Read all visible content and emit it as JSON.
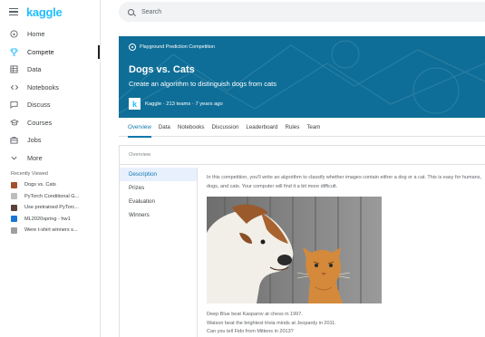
{
  "sidebar": {
    "logo": "kaggle",
    "items": [
      {
        "label": "Home",
        "icon": "home-icon"
      },
      {
        "label": "Compete",
        "icon": "trophy-icon",
        "active": true
      },
      {
        "label": "Data",
        "icon": "table-icon"
      },
      {
        "label": "Notebooks",
        "icon": "code-icon"
      },
      {
        "label": "Discuss",
        "icon": "discuss-icon"
      },
      {
        "label": "Courses",
        "icon": "courses-icon"
      },
      {
        "label": "Jobs",
        "icon": "jobs-icon"
      },
      {
        "label": "More",
        "icon": "chevron-down-icon"
      }
    ],
    "recent_title": "Recently Viewed",
    "recent": [
      {
        "label": "Dogs vs. Cats",
        "color": "#a0522d"
      },
      {
        "label": "PyTorch Conditional G...",
        "color": "#9e9e9e"
      },
      {
        "label": "Use pretrained PyTorc...",
        "color": "#5d4037"
      },
      {
        "label": "ML2020spring - hw1",
        "color": "#1976d2"
      },
      {
        "label": "Were t-shirt winners s...",
        "color": "#9e9e9e"
      }
    ]
  },
  "search": {
    "placeholder": "Search"
  },
  "hero": {
    "badge": "Playground Prediction Competition",
    "title": "Dogs vs. Cats",
    "subtitle": "Create an algorithm to distinguish dogs from cats",
    "host": "Kaggle",
    "teams": "213 teams",
    "age": "7 years ago",
    "host_logo_letter": "k",
    "bg_color": "#0f6e97"
  },
  "tabs": [
    "Overview",
    "Data",
    "Notebooks",
    "Discussion",
    "Leaderboard",
    "Rules",
    "Team"
  ],
  "content": {
    "header": "Overview",
    "left_nav": [
      "Description",
      "Prizes",
      "Evaluation",
      "Winners"
    ],
    "description": "In this competition, you'll write an algorithm to classify whether images contain either a dog or a cat.  This is easy for humans, dogs, and cats. Your computer will find it a bit more difficult.",
    "caption_lines": [
      "Deep Blue beat Kasparov at chess in 1997.",
      "Watson beat the brightest trivia minds at Jeopardy in 2011.",
      "Can you tell Fido from Mittens in 2013?"
    ]
  }
}
